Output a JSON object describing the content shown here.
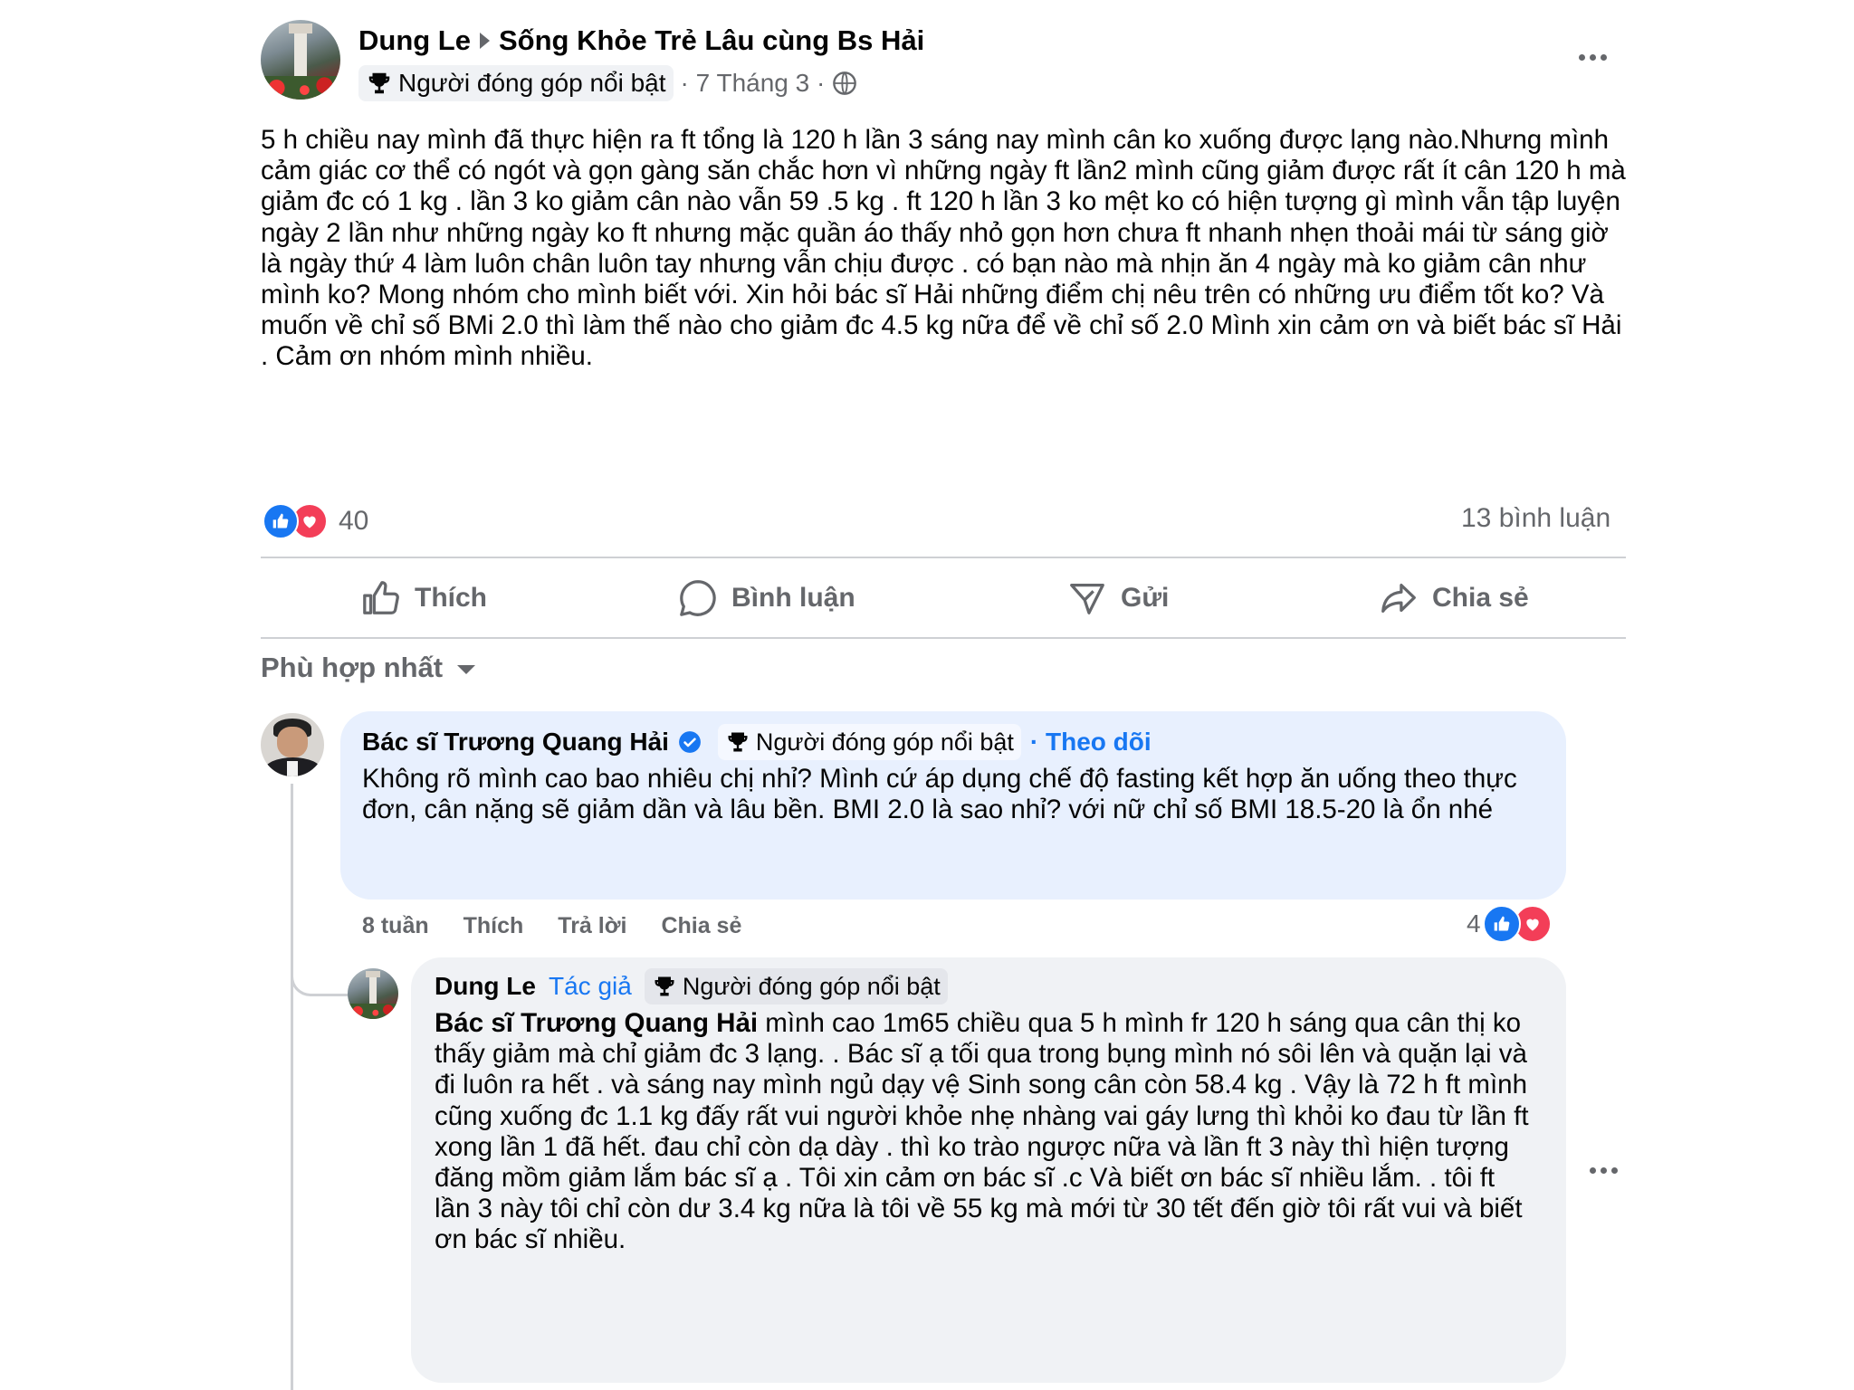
{
  "post": {
    "author": "Dung Le",
    "group": "Sống Khỏe Trẻ Lâu cùng Bs Hải",
    "badge": "Người đóng góp nổi bật",
    "date": "· 7 Tháng 3 ·",
    "text": "5 h chiều nay mình đã thực hiện ra ft tổng là 120 h lần 3  sáng nay mình cân ko xuống được lạng nào.Nhưng mình cảm giác cơ thể có ngót và gọn gàng săn chắc hơn vì những ngày ft lần2 mình cũng giảm được rất ít cân 120 h mà giảm đc có 1 kg . lần 3 ko giảm cân nào vẫn 59 .5 kg . ft 120 h lần 3 ko mệt  ko có hiện tượng gì mình vẫn tập luyện ngày 2 lần như những ngày ko ft   nhưng mặc quần áo thấy nhỏ gọn hơn chưa ft  nhanh nhẹn thoải mái  từ sáng giờ  là ngày thứ 4 làm luôn chân luôn tay nhưng vẫn chịu được . có bạn nào mà nhịn  ăn 4 ngày mà ko giảm cân như mình ko? Mong nhóm cho mình biết với. Xin hỏi bác sĩ Hải những điểm chị nêu trên có những ưu điểm tốt ko? Và muốn về chỉ số BMi 2.0  thì làm thế nào cho giảm đc 4.5 kg nữa để về chỉ số 2.0 Mình xin cảm ơn và  biết bác sĩ Hải . Cảm ơn nhóm mình nhiều.",
    "reaction_count": "40",
    "comment_count": "13 bình luận"
  },
  "actions": {
    "like": "Thích",
    "comment": "Bình luận",
    "send": "Gửi",
    "share": "Chia sẻ"
  },
  "sort": {
    "label": "Phù hợp nhất"
  },
  "comment1": {
    "author": "Bác sĩ Trương Quang Hải",
    "badge": "Người đóng góp nổi bật",
    "follow": "· Theo dõi",
    "text": "Không rõ mình cao bao nhiêu chị nhỉ? Mình cứ áp dụng chế độ fasting kết hợp ăn uống theo thực đơn, cân nặng sẽ giảm dần và lâu bền. BMI 2.0 là sao nhỉ? với nữ chỉ số BMI 18.5-20 là ổn nhé",
    "time": "8 tuần",
    "like": "Thích",
    "reply": "Trả lời",
    "share": "Chia sẻ",
    "reactions": "4"
  },
  "reply1": {
    "author": "Dung Le",
    "author_tag": "Tác giả",
    "badge": "Người đóng góp nổi bật",
    "mention": "Bác sĩ Trương Quang Hải",
    "text": " mình cao 1m65 chiều qua 5 h mình fr 120 h sáng qua cân thị ko thấy giảm mà chỉ giảm đc 3 lạng. . Bác sĩ ạ tối qua trong bụng mình nó sôi lên và quặn lại và đi luôn ra hết . và sáng nay mình ngủ dạy vệ Sinh song cân còn 58.4 kg . Vậy là 72 h ft mình cũng xuống đc 1.1 kg đấy rất vui người khỏe nhẹ nhàng vai gáy lưng thì khỏi ko đau từ lần ft xong lần 1 đã hết. đau chỉ còn dạ dày . thì ko trào ngược nữa và lần ft 3 này thì hiện tượng đăng mồm giảm lắm bác sĩ ạ . Tôi xin cảm ơn bác sĩ .c Và biết ơn bác sĩ nhiều lắm. . tôi ft lần 3 này tôi chỉ còn dư 3.4 kg nữa là tôi về 55 kg mà mới từ 30 tết đến giờ tôi rất vui và biết ơn bác sĩ nhiều."
  },
  "colors": {
    "accent": "#1877f2",
    "love": "#f33e58",
    "muted": "#65676b",
    "bubble_highlight": "#e8f0fe",
    "bubble": "#f0f2f5"
  }
}
